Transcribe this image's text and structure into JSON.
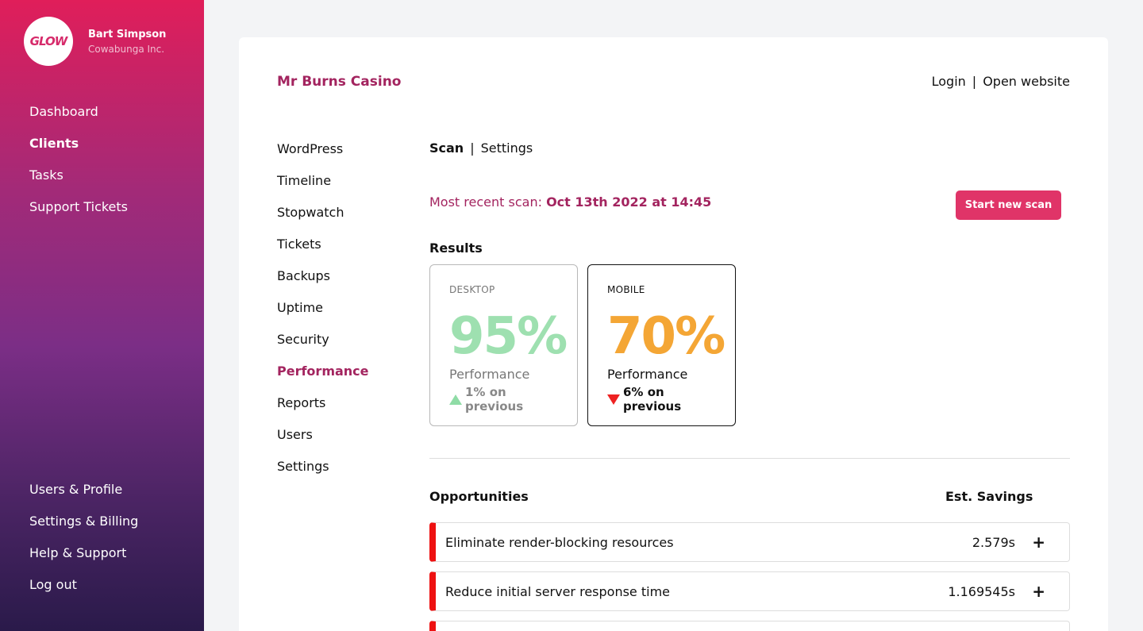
{
  "sidebar": {
    "logo_text": "GLOW",
    "user_name": "Bart Simpson",
    "company": "Cowabunga Inc.",
    "nav": [
      "Dashboard",
      "Clients",
      "Tasks",
      "Support Tickets"
    ],
    "active_nav": "Clients",
    "bottom_nav": [
      "Users & Profile",
      "Settings & Billing",
      "Help & Support",
      "Log out"
    ]
  },
  "header": {
    "site_title": "Mr Burns Casino",
    "login": "Login",
    "separator": "|",
    "open_website": "Open website"
  },
  "subnav": [
    "WordPress",
    "Timeline",
    "Stopwatch",
    "Tickets",
    "Backups",
    "Uptime",
    "Security",
    "Performance",
    "Reports",
    "Users",
    "Settings"
  ],
  "active_subnav": "Performance",
  "tabs": {
    "scan": "Scan",
    "separator": "|",
    "settings": "Settings"
  },
  "scan": {
    "recent_label": "Most recent scan:",
    "recent_value": "Oct 13th 2022 at 14:45",
    "button": "Start new scan"
  },
  "results": {
    "label": "Results",
    "desktop": {
      "label": "DESKTOP",
      "value": "95%",
      "metric": "Performance",
      "change": "1% on previous",
      "direction": "up",
      "color": "#9ee0b0"
    },
    "mobile": {
      "label": "MOBILE",
      "value": "70%",
      "metric": "Performance",
      "change": "6% on previous",
      "direction": "down",
      "color": "#f4a635"
    }
  },
  "opportunities": {
    "label": "Opportunities",
    "savings_label": "Est. Savings",
    "rows": [
      {
        "name": "Eliminate render-blocking resources",
        "value": "2.579s",
        "icon": "plus-icon"
      },
      {
        "name": "Reduce initial server response time",
        "value": "1.169545s",
        "icon": "plus-icon"
      }
    ]
  },
  "colors": {
    "brand": "#a3245f",
    "button": "#e03468",
    "alert": "#ee1111"
  }
}
